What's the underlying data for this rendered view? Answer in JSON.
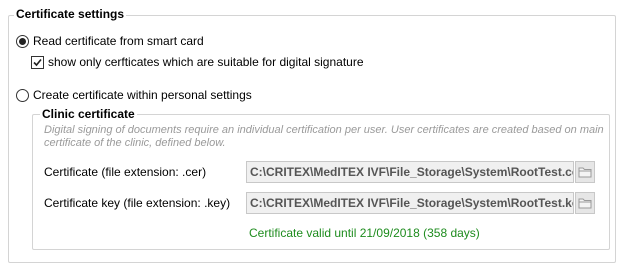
{
  "group": {
    "title": "Certificate settings"
  },
  "options": {
    "smart_card": {
      "label": "Read certificate from smart card",
      "selected": true
    },
    "suitable_only": {
      "label": "show only cerfticates which are suitable for digital signature",
      "checked": true
    },
    "personal": {
      "label": "Create certificate within personal settings",
      "selected": false
    }
  },
  "clinic": {
    "title": "Clinic certificate",
    "description": "Digital signing of documents require an individual certification per user. User certificates are created based on main certificate of the clinic, defined below.",
    "certificate": {
      "label": "Certificate (file extension: .cer)",
      "value": "C:\\CRITEX\\MedITEX IVF\\File_Storage\\System\\RootTest.cer"
    },
    "key": {
      "label": "Certificate key (file extension: .key)",
      "value": "C:\\CRITEX\\MedITEX IVF\\File_Storage\\System\\RootTest.key"
    },
    "status": "Certificate valid until 21/09/2018 (358 days)"
  },
  "colors": {
    "valid_text": "#1e8c1e",
    "description_text": "#9a9a9a",
    "path_text": "#555555",
    "border": "#d4d4d4"
  },
  "icons": {
    "browse": "folder-icon"
  }
}
